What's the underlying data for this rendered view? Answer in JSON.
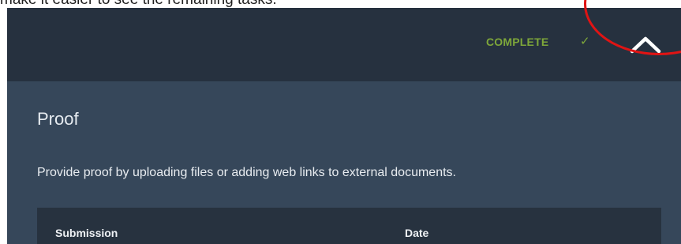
{
  "caption": {
    "text": "make it easier to see the remaining tasks."
  },
  "header": {
    "status_label": "COMPLETE",
    "status_icon": "checkmark-icon",
    "status_color": "#7ea73a",
    "collapse_icon": "chevron-up-icon",
    "background_color": "#26313f"
  },
  "section": {
    "title": "Proof",
    "description": "Provide proof by uploading files or adding web links to external documents.",
    "background_color": "#36475a"
  },
  "table": {
    "columns": [
      "Submission",
      "Date"
    ],
    "header_color": "#27323f"
  },
  "annotation": {
    "type": "red-circle-highlight",
    "color": "#e01414"
  }
}
